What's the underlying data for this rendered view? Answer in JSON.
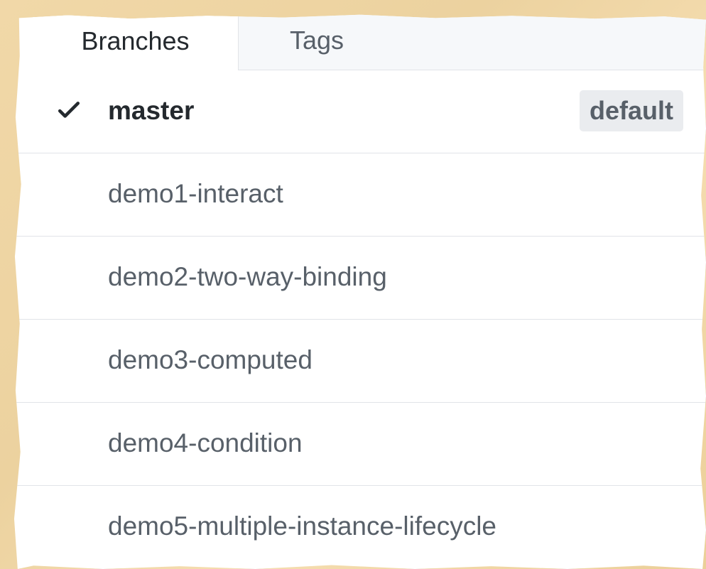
{
  "tabs": [
    {
      "label": "Branches",
      "active": true
    },
    {
      "label": "Tags",
      "active": false
    }
  ],
  "branches": [
    {
      "name": "master",
      "selected": true,
      "badge": "default"
    },
    {
      "name": "demo1-interact",
      "selected": false
    },
    {
      "name": "demo2-two-way-binding",
      "selected": false
    },
    {
      "name": "demo3-computed",
      "selected": false
    },
    {
      "name": "demo4-condition",
      "selected": false
    },
    {
      "name": "demo5-multiple-instance-lifecycle",
      "selected": false
    }
  ],
  "icons": {
    "selected_branch": "check-icon"
  },
  "colors": {
    "background": "#efd49f",
    "text_primary": "#24292e",
    "text_secondary": "#586069",
    "divider": "#e1e4e8",
    "badge_background": "#eaecef"
  }
}
